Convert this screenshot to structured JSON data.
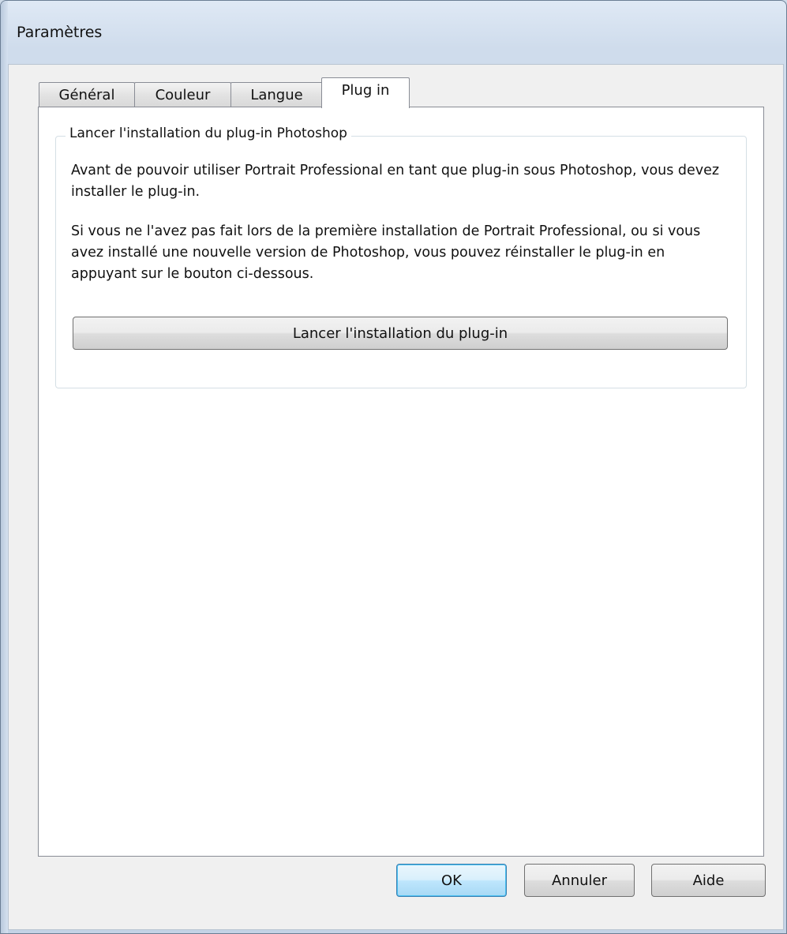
{
  "window": {
    "title": "Paramètres"
  },
  "tabs": [
    {
      "label": "Général",
      "active": false
    },
    {
      "label": "Couleur",
      "active": false
    },
    {
      "label": "Langue",
      "active": false
    },
    {
      "label": "Plug in",
      "active": true
    }
  ],
  "plugin_panel": {
    "group_title": "Lancer l'installation du plug-in Photoshop",
    "paragraph_1": "Avant de pouvoir utiliser Portrait Professional en tant que plug-in sous Photoshop, vous devez installer le plug-in.",
    "paragraph_2": "Si vous ne l'avez pas fait lors de la première installation de Portrait Professional, ou si vous avez installé une nouvelle version de Photoshop, vous pouvez réinstaller le plug-in en appuyant sur le bouton ci-dessous.",
    "install_button_label": "Lancer l'installation du plug-in"
  },
  "footer": {
    "ok_label": "OK",
    "cancel_label": "Annuler",
    "help_label": "Aide"
  },
  "colors": {
    "window_frame": "#cfdcec",
    "client_background": "#f0f0f0",
    "panel_background": "#ffffff",
    "default_button_border": "#3c7fb1"
  }
}
